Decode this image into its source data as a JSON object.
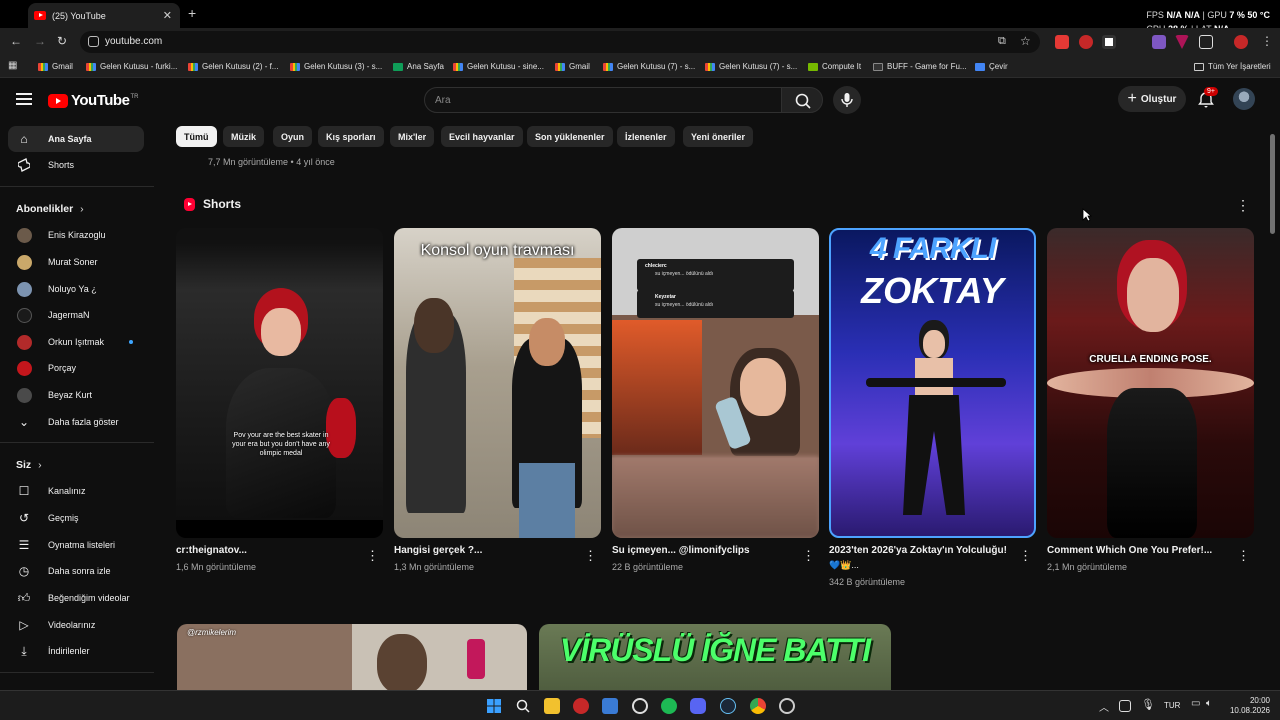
{
  "browser": {
    "tab_title": "(25) YouTube",
    "url": "youtube.com",
    "overlay": {
      "fps_label": "FPS",
      "fps_val1": "N/A",
      "fps_val2": "N/A",
      "gpu_label": "GPU",
      "gpu_val": "7 %",
      "gpu_temp": "50 °C",
      "cpu_label": "CPU",
      "cpu_val": "28 %",
      "lat_label": "LAT",
      "lat_val": "N/A"
    },
    "bookmarks": [
      {
        "label": "Gmail",
        "icon": "gmail-icon"
      },
      {
        "label": "Gelen Kutusu - furki...",
        "icon": "gmail-icon"
      },
      {
        "label": "Gelen Kutusu (2) - f...",
        "icon": "gmail-icon"
      },
      {
        "label": "Gelen Kutusu (3) - s...",
        "icon": "gmail-icon"
      },
      {
        "label": "Ana Sayfa",
        "icon": "kick-icon"
      },
      {
        "label": "Gelen Kutusu - sine...",
        "icon": "gmail-icon"
      },
      {
        "label": "Gmail",
        "icon": "gmail-icon"
      },
      {
        "label": "Gelen Kutusu (7) - s...",
        "icon": "gmail-icon"
      },
      {
        "label": "Gelen Kutusu (7) - s...",
        "icon": "gmail-icon"
      },
      {
        "label": "Compute It",
        "icon": "compute-icon"
      },
      {
        "label": "BUFF - Game for Fu...",
        "icon": "buff-icon"
      },
      {
        "label": "Çevir",
        "icon": "translate-icon"
      }
    ],
    "all_bookmarks": "Tüm Yer İşaretleri"
  },
  "header": {
    "logo_text": "YouTube",
    "logo_country": "TR",
    "search_placeholder": "Ara",
    "create_label": "Oluştur",
    "notification_count": "9+"
  },
  "sidebar": {
    "main": [
      {
        "label": "Ana Sayfa",
        "icon": "home-icon"
      },
      {
        "label": "Shorts",
        "icon": "shorts-icon"
      }
    ],
    "subscriptions_title": "Abonelikler",
    "subscriptions": [
      {
        "label": "Enis Kirazoglu",
        "color": "#6b5a4a"
      },
      {
        "label": "Murat Soner",
        "color": "#c9a86a"
      },
      {
        "label": "Noluyo Ya ¿",
        "color": "#7c93b0"
      },
      {
        "label": "JagermaN",
        "color": "#1a1a1a"
      },
      {
        "label": "Orkun Işıtmak",
        "color": "#b22a2a"
      },
      {
        "label": "Porçay",
        "color": "#c4161c"
      },
      {
        "label": "Beyaz Kurt",
        "color": "#4a4a4a"
      }
    ],
    "show_more": "Daha fazla göster",
    "you_title": "Siz",
    "you_items": [
      {
        "label": "Kanalınız",
        "icon": "channel-icon"
      },
      {
        "label": "Geçmiş",
        "icon": "history-icon"
      },
      {
        "label": "Oynatma listeleri",
        "icon": "playlist-icon"
      },
      {
        "label": "Daha sonra izle",
        "icon": "clock-icon"
      },
      {
        "label": "Beğendiğim videolar",
        "icon": "thumbs-up-icon"
      },
      {
        "label": "Videolarınız",
        "icon": "video-icon"
      },
      {
        "label": "İndirilenler",
        "icon": "download-icon"
      }
    ]
  },
  "chips": [
    "Tümü",
    "Müzik",
    "Oyun",
    "Kış sporları",
    "Mix'ler",
    "Evcil hayvanlar",
    "Son yüklenenler",
    "İzlenenler",
    "Yeni öneriler"
  ],
  "prev_video_meta": "7,7 Mn görüntüleme • 4 yıl önce",
  "shorts_section": {
    "title": "Shorts",
    "items": [
      {
        "title": "cr:theignatov...",
        "views": "1,6 Mn görüntüleme",
        "overlay": "Pov your are the best skater in your era but you don't have any olimpic medal"
      },
      {
        "title": "Hangisi gerçek ?...",
        "views": "1,3 Mn görüntüleme",
        "overlay": "Konsol oyun travması"
      },
      {
        "title": "Su içmeyen... @limonifyclips",
        "views": "22 B görüntüleme",
        "chat1_user": "chlecierc",
        "chat1_msg": "su içmeyen... ödülünü aldı",
        "chat2_user": "Keyzetar",
        "chat2_msg": "su içmeyen... ödülünü aldı"
      },
      {
        "title": "2023'ten 2026'ya Zoktay'ın Yolculuğu!",
        "title2": "💙👑...",
        "views": "342 B görüntüleme",
        "overlay1": "4 FARKLI",
        "overlay2": "ZOKTAY"
      },
      {
        "title": "Comment Which One You Prefer!...",
        "views": "2,1 Mn görüntüleme",
        "overlay": "CRUELLA ENDING POSE."
      }
    ]
  },
  "bottom_videos": [
    {
      "overlay": "@rzmikelerim"
    },
    {
      "overlay": "VİRÜSLÜ İĞNE BATTI"
    }
  ],
  "taskbar": {
    "lang": "TUR",
    "time": "20:00",
    "date": "10.08.2026"
  }
}
